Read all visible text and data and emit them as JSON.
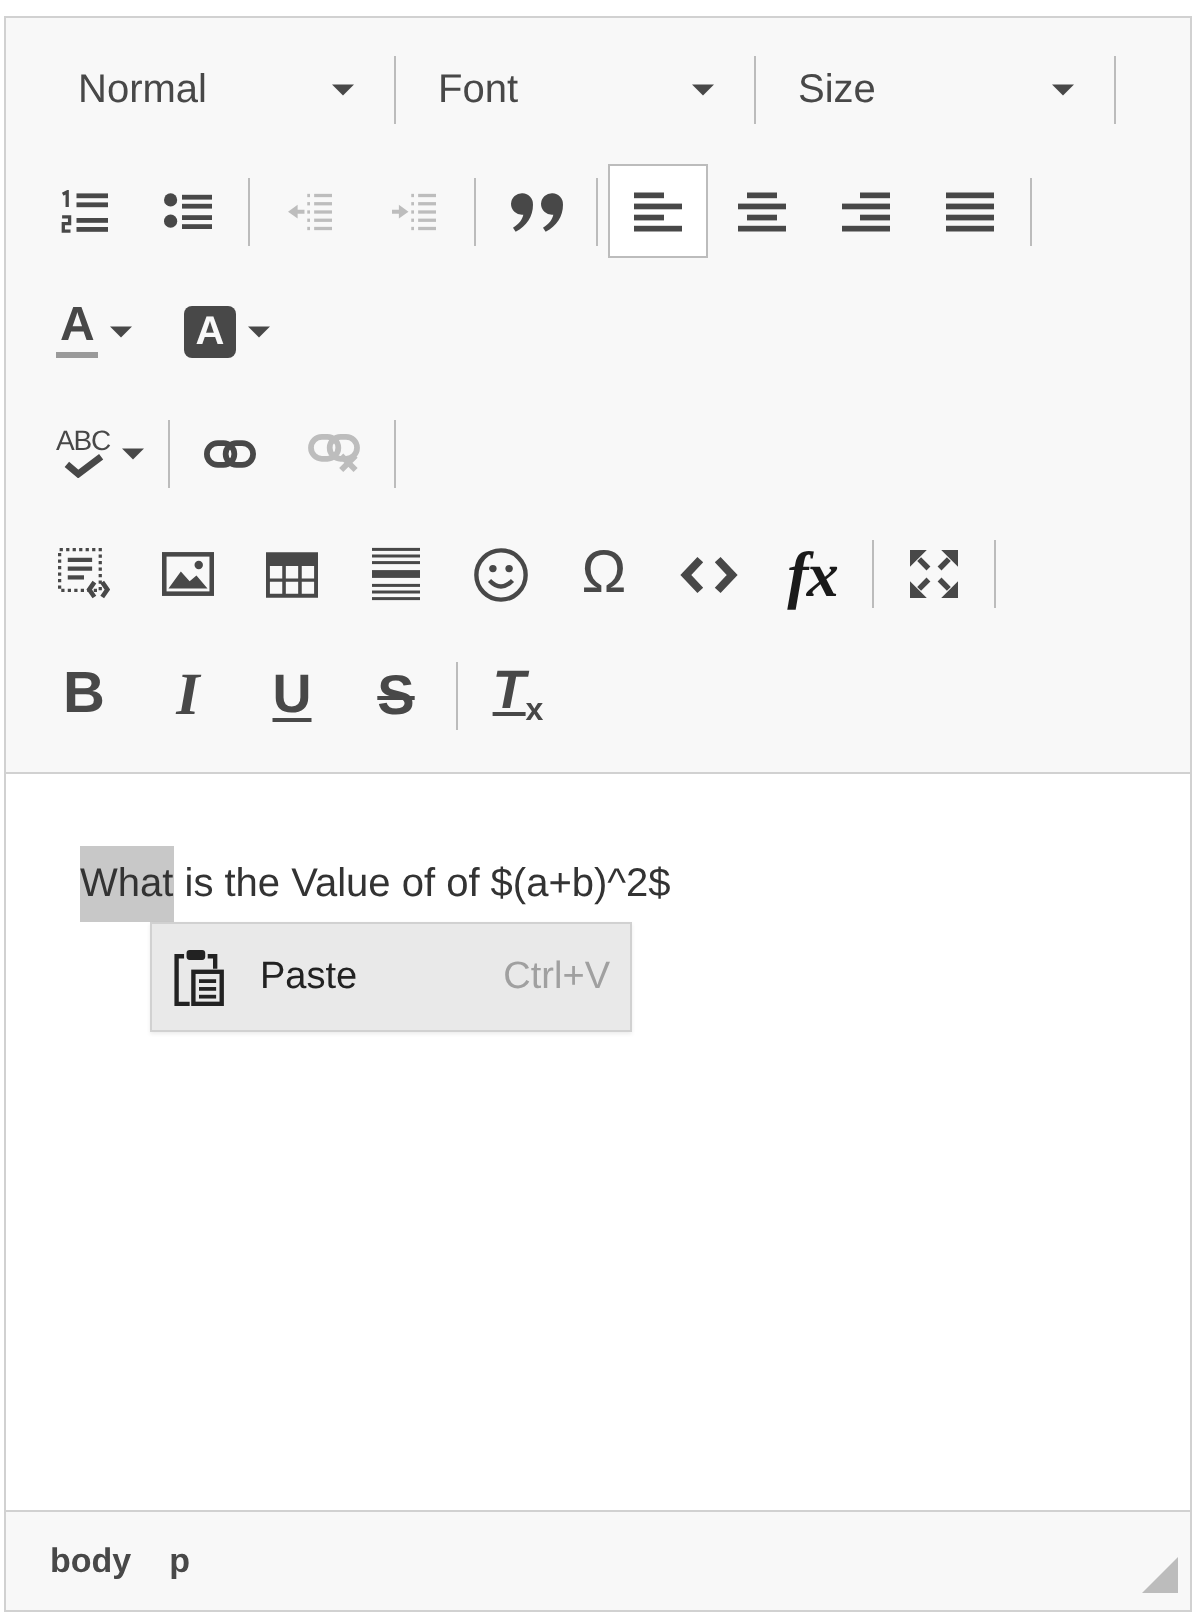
{
  "toolbar": {
    "rows": [
      {
        "items": [
          {
            "kind": "dropdown",
            "label": "Normal"
          },
          {
            "kind": "separator"
          },
          {
            "kind": "dropdown",
            "label": "Font"
          },
          {
            "kind": "separator"
          },
          {
            "kind": "dropdown",
            "label": "Size"
          },
          {
            "kind": "separator"
          }
        ]
      },
      {
        "items": [
          {
            "kind": "button",
            "selected": false,
            "disabled": false
          },
          {
            "kind": "button",
            "selected": false,
            "disabled": false
          },
          {
            "kind": "separator"
          },
          {
            "kind": "button",
            "selected": false,
            "disabled": true
          },
          {
            "kind": "button",
            "selected": false,
            "disabled": true
          },
          {
            "kind": "separator"
          },
          {
            "kind": "button",
            "selected": false,
            "disabled": false
          },
          {
            "kind": "separator"
          },
          {
            "kind": "button",
            "selected": true,
            "disabled": false
          },
          {
            "kind": "button",
            "selected": false,
            "disabled": false
          },
          {
            "kind": "button",
            "selected": false,
            "disabled": false
          },
          {
            "kind": "button",
            "selected": false,
            "disabled": false
          },
          {
            "kind": "separator"
          }
        ]
      },
      {
        "items": [
          {
            "kind": "split",
            "label": "A",
            "disabled": false
          },
          {
            "kind": "split",
            "label": "A",
            "disabled": false
          }
        ]
      },
      {
        "items": [
          {
            "kind": "split",
            "label": "ABC",
            "disabled": false
          },
          {
            "kind": "separator"
          },
          {
            "kind": "button",
            "selected": false,
            "disabled": false
          },
          {
            "kind": "button",
            "selected": false,
            "disabled": true
          },
          {
            "kind": "separator"
          }
        ]
      },
      {
        "items": [
          {
            "kind": "button",
            "selected": false,
            "disabled": false
          },
          {
            "kind": "button",
            "selected": false,
            "disabled": false
          },
          {
            "kind": "button",
            "selected": false,
            "disabled": false
          },
          {
            "kind": "button",
            "selected": false,
            "disabled": false
          },
          {
            "kind": "button",
            "selected": false,
            "disabled": false
          },
          {
            "kind": "button",
            "label": "Ω",
            "selected": false,
            "disabled": false
          },
          {
            "kind": "button",
            "selected": false,
            "disabled": false
          },
          {
            "kind": "button",
            "label": "fx",
            "selected": false,
            "disabled": false
          },
          {
            "kind": "separator"
          },
          {
            "kind": "button",
            "selected": false,
            "disabled": false
          },
          {
            "kind": "separator"
          }
        ]
      },
      {
        "items": [
          {
            "kind": "button",
            "label": "B",
            "selected": false,
            "disabled": false
          },
          {
            "kind": "button",
            "label": "I",
            "selected": false,
            "disabled": false
          },
          {
            "kind": "button",
            "label": "U",
            "selected": false,
            "disabled": false
          },
          {
            "kind": "button",
            "label": "S",
            "selected": false,
            "disabled": false
          },
          {
            "kind": "separator"
          },
          {
            "kind": "button",
            "label": "T$_{x}$",
            "selected": false,
            "disabled": false
          }
        ]
      }
    ]
  },
  "editor": {
    "segments": [
      {
        "text": "What",
        "selected": true
      },
      {
        "text": " is the Value of of $(a+b)^2$",
        "selected": false
      }
    ]
  },
  "context_menu": {
    "items": [
      {
        "label": "Paste",
        "shortcut": "Ctrl+V",
        "selected": true
      }
    ]
  },
  "status_bar": {
    "path": [
      "body",
      "p"
    ]
  }
}
